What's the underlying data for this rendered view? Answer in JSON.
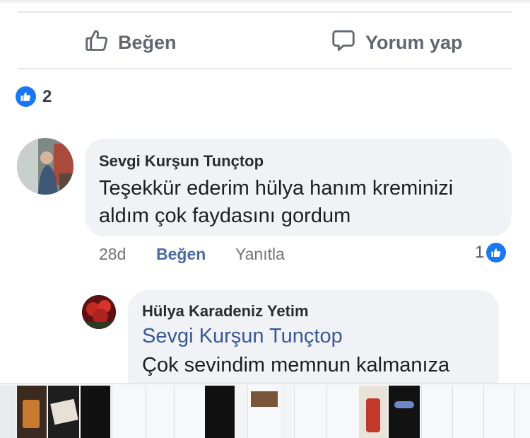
{
  "actions": {
    "like_label": "Beğen",
    "comment_label": "Yorum yap"
  },
  "reactions": {
    "count": "2"
  },
  "comment": {
    "author": "Sevgi Kurşun Tunçtop",
    "text_line1": "Teşekkür ederim hülya hanım kreminizi",
    "text_line2": "aldım çok faydasını gordum",
    "time": "28d",
    "like_label": "Beğen",
    "reply_label": "Yanıtla",
    "reaction_count": "1"
  },
  "reply": {
    "author": "Hülya Karadeniz Yetim",
    "mention": "Sevgi Kurşun Tunçtop",
    "text": "Çok sevindim memnun kalmanıza"
  },
  "colors": {
    "accent": "#1877f2",
    "bubble": "#f0f2f5",
    "link": "#385898"
  },
  "icons": [
    "thumbs-up-outline-icon",
    "speech-bubble-icon",
    "like-reaction-icon"
  ]
}
